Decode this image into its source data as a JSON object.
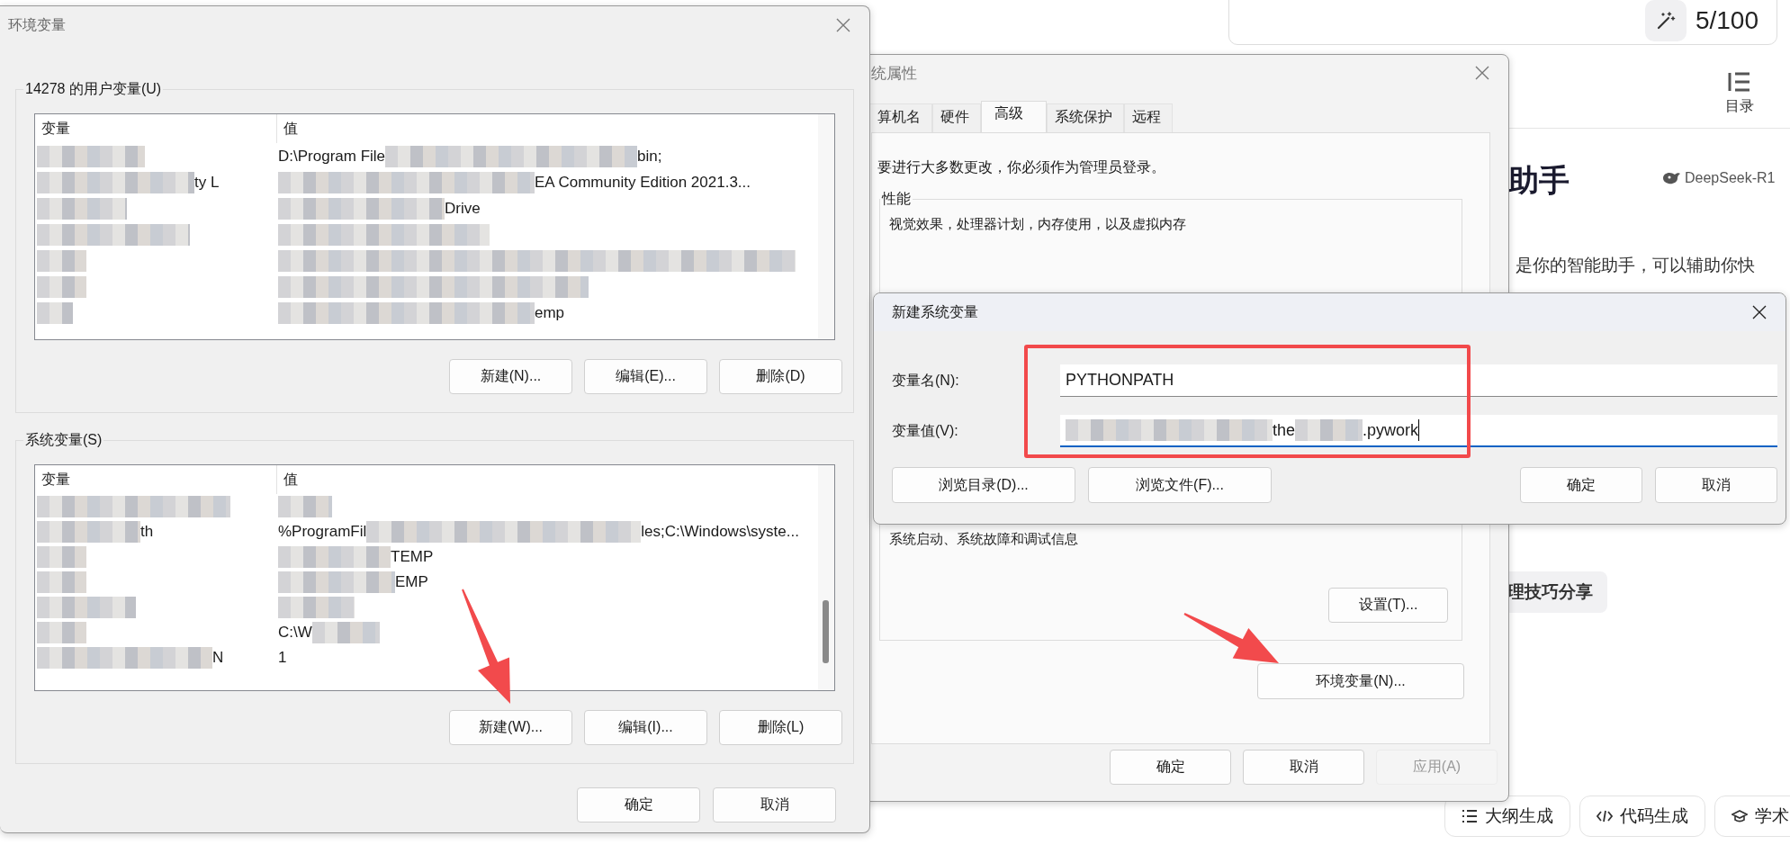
{
  "assistant_page": {
    "counter": "5/100",
    "toc_label": "目录",
    "title": "助手",
    "model": "DeepSeek-R1",
    "intro": "是你的智能助手，可以辅助你快",
    "chip": "理技巧分享",
    "actions": [
      {
        "kind": "outline",
        "label": "大纲生成"
      },
      {
        "kind": "code",
        "label": "代码生成"
      },
      {
        "kind": "academic",
        "label": "学术"
      }
    ]
  },
  "system_properties": {
    "title": "统属性",
    "tabs": [
      {
        "label": "算机名",
        "selected": false
      },
      {
        "label": "硬件",
        "selected": false
      },
      {
        "label": "高级",
        "selected": true
      },
      {
        "label": "系统保护",
        "selected": false
      },
      {
        "label": "远程",
        "selected": false
      }
    ],
    "notice": "要进行大多数更改，你必须作为管理员登录。",
    "performance": {
      "label": "性能",
      "description": "视觉效果，处理器计划，内存使用，以及虚拟内存"
    },
    "startup": {
      "description": "系统启动、系统故障和调试信息",
      "button": "设置(T)..."
    },
    "env_button": "环境变量(N)...",
    "buttons": [
      {
        "label": "确定",
        "disabled": false
      },
      {
        "label": "取消",
        "disabled": false
      },
      {
        "label": "应用(A)",
        "disabled": true
      }
    ]
  },
  "env_dialog": {
    "title": "环境变量",
    "user_group": {
      "label": "14278 的用户变量(U)",
      "columns": [
        "变量",
        "值"
      ],
      "rows": [
        {
          "name": [
            {
              "kind": "blur"
            }
          ],
          "value": [
            {
              "kind": "text",
              "text": "D:\\Program File"
            },
            {
              "kind": "blur"
            },
            {
              "kind": "text",
              "text": "bin;"
            }
          ]
        },
        {
          "name": [
            {
              "kind": "blur"
            },
            {
              "kind": "text",
              "text": "ty L"
            }
          ],
          "value": [
            {
              "kind": "blur"
            },
            {
              "kind": "text",
              "text": "EA Community Edition 2021.3..."
            }
          ]
        },
        {
          "name": [
            {
              "kind": "blur"
            }
          ],
          "value": [
            {
              "kind": "blur"
            },
            {
              "kind": "text",
              "text": "Drive"
            }
          ]
        },
        {
          "name": [
            {
              "kind": "blur"
            }
          ],
          "value": [
            {
              "kind": "blur"
            }
          ]
        },
        {
          "name": [
            {
              "kind": "blur"
            }
          ],
          "value": [
            {
              "kind": "blur"
            }
          ]
        },
        {
          "name": [
            {
              "kind": "blur"
            }
          ],
          "value": [
            {
              "kind": "blur"
            }
          ]
        },
        {
          "name": [
            {
              "kind": "blur"
            }
          ],
          "value": [
            {
              "kind": "blur"
            },
            {
              "kind": "text",
              "text": "emp"
            }
          ]
        }
      ],
      "buttons": [
        "新建(N)...",
        "编辑(E)...",
        "删除(D)"
      ]
    },
    "system_group": {
      "label": "系统变量(S)",
      "columns": [
        "变量",
        "值"
      ],
      "rows": [
        {
          "name": [
            {
              "kind": "blur"
            }
          ],
          "value": [
            {
              "kind": "blur"
            }
          ]
        },
        {
          "name": [
            {
              "kind": "blur"
            },
            {
              "kind": "text",
              "text": "th"
            }
          ],
          "value": [
            {
              "kind": "text",
              "text": "%ProgramFil"
            },
            {
              "kind": "blur"
            },
            {
              "kind": "text",
              "text": "les;C:\\Windows\\syste..."
            }
          ]
        },
        {
          "name": [
            {
              "kind": "blur"
            }
          ],
          "value": [
            {
              "kind": "blur"
            },
            {
              "kind": "text",
              "text": "TEMP"
            }
          ]
        },
        {
          "name": [
            {
              "kind": "blur"
            }
          ],
          "value": [
            {
              "kind": "blur"
            },
            {
              "kind": "text",
              "text": "EMP"
            }
          ]
        },
        {
          "name": [
            {
              "kind": "blur"
            }
          ],
          "value": [
            {
              "kind": "blur"
            }
          ]
        },
        {
          "name": [
            {
              "kind": "blur"
            }
          ],
          "value": [
            {
              "kind": "text",
              "text": "C:\\W"
            },
            {
              "kind": "blur"
            }
          ]
        },
        {
          "name": [
            {
              "kind": "blur"
            },
            {
              "kind": "text",
              "text": "N"
            }
          ],
          "value": [
            {
              "kind": "text",
              "text": "1"
            }
          ]
        }
      ],
      "buttons": [
        "新建(W)...",
        "编辑(I)...",
        "删除(L)"
      ]
    },
    "buttons": [
      "确定",
      "取消"
    ]
  },
  "new_variable_dialog": {
    "title": "新建系统变量",
    "fields": [
      {
        "label": "变量名(N):",
        "focused": false,
        "value": [
          {
            "kind": "text",
            "text": "PYTHONPATH"
          }
        ]
      },
      {
        "label": "变量值(V):",
        "focused": true,
        "value": [
          {
            "kind": "blur"
          },
          {
            "kind": "text",
            "text": "the"
          },
          {
            "kind": "blur"
          },
          {
            "kind": "text",
            "text": ".pywork"
          }
        ]
      }
    ],
    "browse_buttons": [
      "浏览目录(D)...",
      "浏览文件(F)..."
    ],
    "buttons": [
      "确定",
      "取消"
    ]
  }
}
